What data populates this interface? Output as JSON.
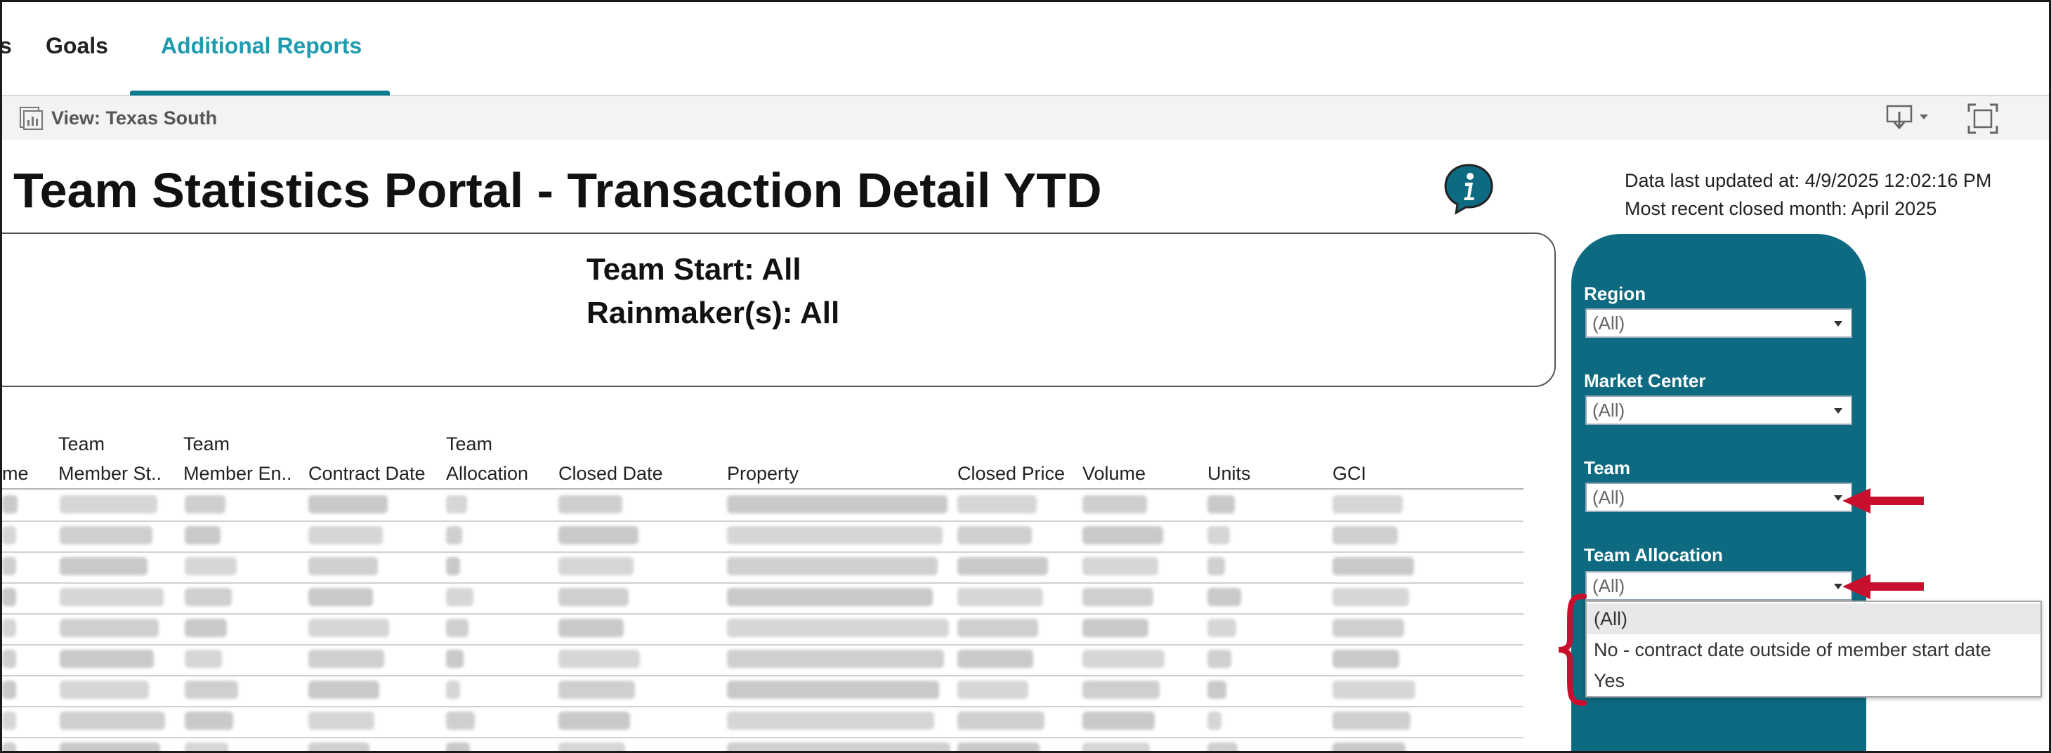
{
  "tabs": {
    "partial_label": "s",
    "goals_label": "Goals",
    "active_label": "Additional Reports"
  },
  "toolbar": {
    "view_label": "View: Texas South",
    "icons": [
      "view-icon",
      "download-icon",
      "fullscreen-icon"
    ]
  },
  "dashboard": {
    "title": "Team Statistics Portal - Transaction Detail YTD",
    "info_icon": "info-icon",
    "last_updated": "Data last updated at: 4/9/2025 12:02:16 PM",
    "recent_month": "Most recent closed month: April 2025",
    "summary": {
      "team_start": "Team Start: All",
      "rainmakers": "Rainmaker(s): All"
    }
  },
  "table": {
    "columns": [
      {
        "line1": "",
        "line2": "me"
      },
      {
        "line1": "Team",
        "line2": "Member St.."
      },
      {
        "line1": "Team",
        "line2": "Member En.."
      },
      {
        "line1": "",
        "line2": "Contract Date"
      },
      {
        "line1": "Team",
        "line2": "Allocation"
      },
      {
        "line1": "",
        "line2": "Closed Date"
      },
      {
        "line1": "",
        "line2": "Property"
      },
      {
        "line1": "",
        "line2": "Closed Price"
      },
      {
        "line1": "",
        "line2": "Volume"
      },
      {
        "line1": "",
        "line2": "Units"
      },
      {
        "line1": "",
        "line2": "GCI"
      }
    ],
    "row_count": 9,
    "cells_blurred": true
  },
  "filters": {
    "region": {
      "label": "Region",
      "value": "(All)"
    },
    "market_center": {
      "label": "Market Center",
      "value": "(All)"
    },
    "team": {
      "label": "Team",
      "value": "(All)"
    },
    "team_allocation": {
      "label": "Team Allocation",
      "value": "(All)",
      "options": [
        "(All)",
        "No - contract date outside of member start date",
        "Yes"
      ]
    }
  },
  "colors": {
    "accent_teal": "#1f9bb0",
    "panel": "#0e6a80",
    "annotation_red": "#c8102e"
  }
}
